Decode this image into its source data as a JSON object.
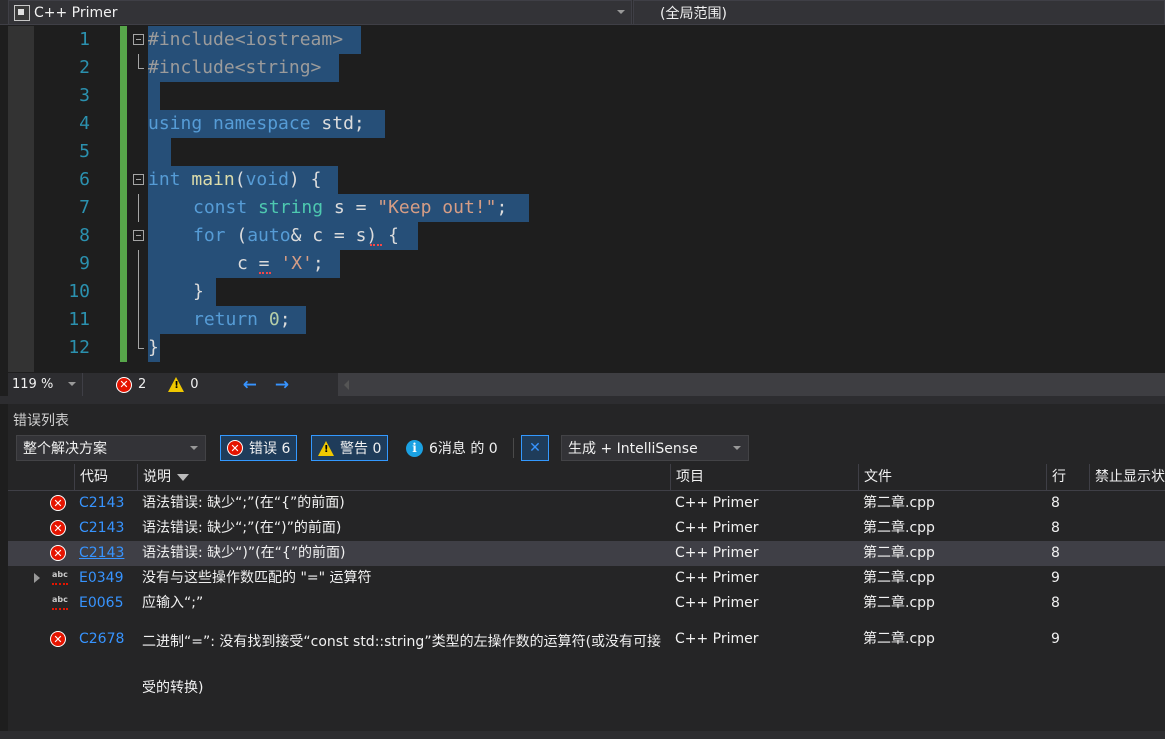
{
  "navbar": {
    "project": "C++ Primer",
    "scope": "(全局范围)"
  },
  "editor": {
    "line_numbers": [
      "1",
      "2",
      "3",
      "4",
      "5",
      "6",
      "7",
      "8",
      "9",
      "10",
      "11",
      "12"
    ],
    "lines": {
      "l1": {
        "pp": "#include<iostream>"
      },
      "l2": {
        "pp": "#include<string>"
      },
      "l4": {
        "kw1": "using",
        "kw2": "namespace",
        "rest": " std;"
      },
      "l6": {
        "kw1": "int",
        "fn": "main",
        "p1": "(",
        "kw2": "void",
        "p2": ") {"
      },
      "l7": {
        "kw": "const",
        "ty": "string",
        "mid": " s = ",
        "str": "\"Keep out!\"",
        "end": ";"
      },
      "l8": {
        "kw1": "for",
        "p1": " (",
        "kw2": "auto",
        "rest": "& c = s) {"
      },
      "l9": {
        "pre": "c = ",
        "str": "'X'",
        "end": ";"
      },
      "l10": {
        "text": "}"
      },
      "l11": {
        "kw": "return",
        "num": "0",
        "end": ";"
      },
      "l12": {
        "text": "}"
      }
    }
  },
  "status": {
    "zoom": "119 %",
    "errors": "2",
    "warnings": "0",
    "back_icon": "←",
    "fwd_icon": "→"
  },
  "error_list": {
    "title": "错误列表",
    "scope": "整个解决方案",
    "errors_btn": "错误 6",
    "warnings_btn": "警告 0",
    "messages_btn": "6消息 的 0",
    "source": "生成 + IntelliSense",
    "columns": {
      "code": "代码",
      "desc": "说明",
      "project": "项目",
      "file": "文件",
      "line": "行",
      "suppress": "禁止显示状"
    },
    "rows": [
      {
        "code": "C2143",
        "desc": "语法错误: 缺少“;”(在“{”的前面)",
        "project": "C++ Primer",
        "file": "第二章.cpp",
        "line": "8"
      },
      {
        "code": "C2143",
        "desc": "语法错误: 缺少“;”(在“)”的前面)",
        "project": "C++ Primer",
        "file": "第二章.cpp",
        "line": "8"
      },
      {
        "code": "C2143",
        "desc": "语法错误: 缺少“)”(在“{”的前面)",
        "project": "C++ Primer",
        "file": "第二章.cpp",
        "line": "8"
      },
      {
        "code": "E0349",
        "desc": "没有与这些操作数匹配的 \"=\" 运算符",
        "project": "C++ Primer",
        "file": "第二章.cpp",
        "line": "9"
      },
      {
        "code": "E0065",
        "desc": "应输入“;”",
        "project": "C++ Primer",
        "file": "第二章.cpp",
        "line": "8"
      },
      {
        "code": "C2678",
        "desc": "二进制“=”: 没有找到接受“const std::string”类型的左操作数的运算符(或没有可接受的转换)",
        "project": "C++ Primer",
        "file": "第二章.cpp",
        "line": "9"
      }
    ]
  },
  "colors": {
    "error": "#e51400",
    "warning": "#f0c800",
    "info": "#1ba1e2",
    "link": "#3794ff",
    "selection": "#264f78"
  }
}
